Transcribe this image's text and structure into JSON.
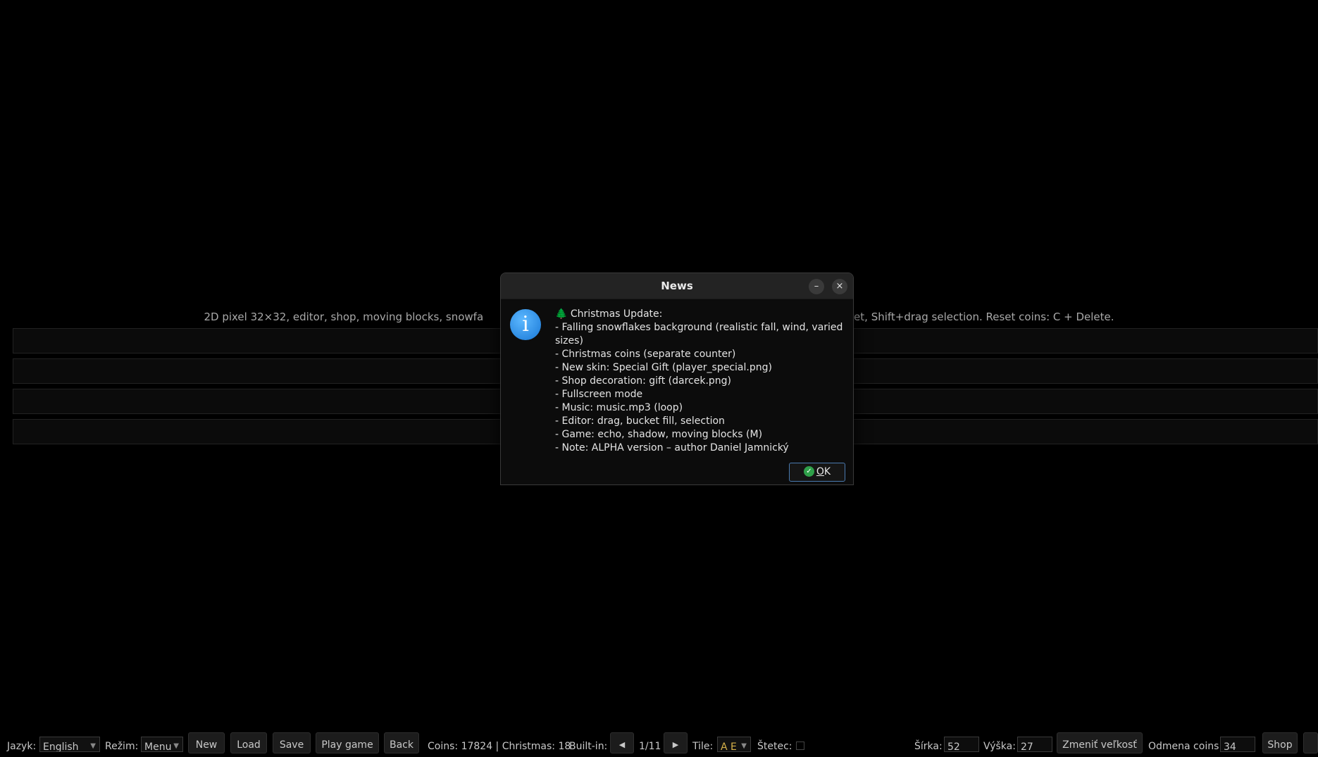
{
  "subtitle_left": "2D pixel 32×32, editor, shop, moving blocks, snowfa",
  "subtitle_right": "ucket, Shift+drag selection. Reset coins: C + Delete.",
  "menu_bars": [
    "",
    "",
    "",
    ""
  ],
  "dialog": {
    "title": "News",
    "minimize_glyph": "–",
    "close_glyph": "×",
    "info_glyph": "i",
    "tree_glyph": "🌲",
    "heading": "Christmas Update:",
    "lines": [
      "- Falling snowflakes background (realistic fall, wind, varied sizes)",
      "- Christmas coins (separate counter)",
      "- New skin: Special Gift (player_special.png)",
      "- Shop decoration: gift (darcek.png)",
      "- Fullscreen mode",
      "- Music: music.mp3 (loop)",
      "- Editor: drag, bucket fill, selection",
      "- Game: echo, shadow, moving blocks (M)",
      "- Note: ALPHA version – author Daniel Jamnický"
    ],
    "ok_label_underlined": "O",
    "ok_label_rest": "K",
    "ok_check_glyph": "✓"
  },
  "toolbar": {
    "language_label": "Jazyk:",
    "language_value": "English",
    "mode_label": "Režim:",
    "mode_value": "Menu",
    "new_label": "New",
    "load_label": "Load",
    "save_label": "Save",
    "play_label": "Play game",
    "back_label": "Back",
    "coins_text": "Coins: 17824 | Christmas: 18",
    "builtin_label": "Built-in:",
    "prev_glyph": "◀",
    "page_text": "1/11",
    "next_glyph": "▶",
    "tile_label": "Tile:",
    "tile_value": "A E",
    "brush_label": "Štetec:",
    "width_label": "Šírka:",
    "width_value": "52",
    "height_label": "Výška:",
    "height_value": "27",
    "resize_label": "Zmeniť veľkosť",
    "reward_label": "Odmena coins:",
    "reward_value": "34",
    "shop_label": "Shop"
  }
}
